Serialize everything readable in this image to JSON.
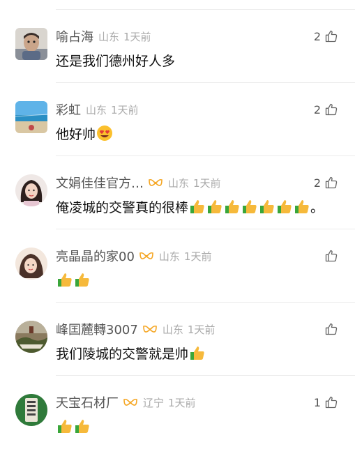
{
  "colors": {
    "text": "#111111",
    "username": "#555555",
    "meta": "#aaaaaa",
    "divider": "#ececec",
    "verified": "#f5a623",
    "thumb_hand": "#f6b93b",
    "thumb_cuff": "#3aa63a"
  },
  "comments": [
    {
      "username": "喻占海",
      "verified": false,
      "location": "山东",
      "time": "1天前",
      "likes": "2",
      "text": "还是我们德州好人多",
      "emoji": [],
      "trailing": "",
      "avatar": "child-photo"
    },
    {
      "username": "彩虹",
      "verified": false,
      "location": "山东",
      "time": "1天前",
      "likes": "2",
      "text": "他好帅",
      "emoji": [
        "heart-eyes-emoji"
      ],
      "trailing": "",
      "avatar": "beach-photo"
    },
    {
      "username": "文娟佳佳官方…",
      "verified": true,
      "location": "山东",
      "time": "1天前",
      "likes": "2",
      "text": "俺凌城的交警真的很棒",
      "emoji": [
        "thumbs-up-emoji",
        "thumbs-up-emoji",
        "thumbs-up-emoji",
        "thumbs-up-emoji",
        "thumbs-up-emoji",
        "thumbs-up-emoji",
        "thumbs-up-emoji"
      ],
      "trailing": "。",
      "avatar": "woman-photo"
    },
    {
      "username": "亮晶晶的家00",
      "verified": true,
      "location": "山东",
      "time": "1天前",
      "likes": "",
      "text": "",
      "emoji": [
        "thumbs-up-emoji",
        "thumbs-up-emoji"
      ],
      "trailing": "",
      "avatar": "girl-photo"
    },
    {
      "username": "峰囯麓轉3007",
      "verified": true,
      "location": "山东",
      "time": "1天前",
      "likes": "",
      "text": "我们陵城的交警就是帅",
      "emoji": [
        "thumbs-up-emoji"
      ],
      "trailing": "",
      "avatar": "landscape-photo"
    },
    {
      "username": "天宝石材厂",
      "verified": true,
      "location": "辽宁",
      "time": "1天前",
      "likes": "1",
      "text": "",
      "emoji": [
        "thumbs-up-emoji",
        "thumbs-up-emoji"
      ],
      "trailing": "",
      "avatar": "stone-sign-photo"
    }
  ]
}
